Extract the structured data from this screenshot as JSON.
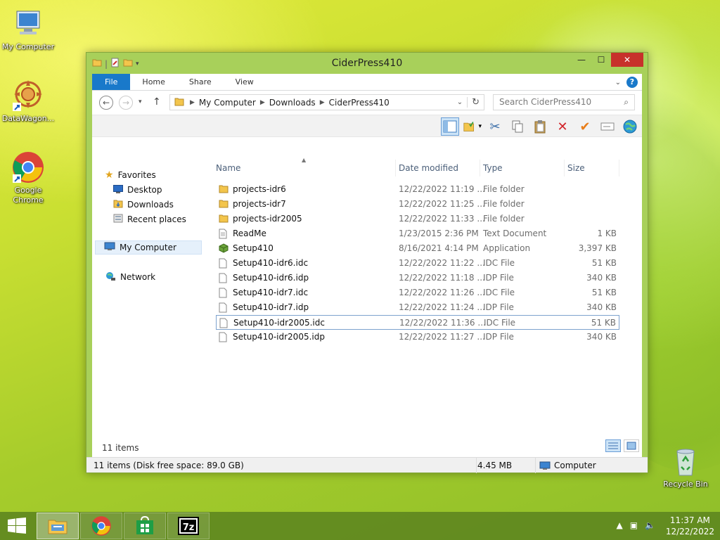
{
  "desktop": {
    "icons": [
      {
        "label": "My Computer"
      },
      {
        "label": "DataWagon..."
      },
      {
        "label": "Google Chrome"
      },
      {
        "label": "Recycle Bin"
      }
    ]
  },
  "window": {
    "title": "CiderPress410",
    "controls": {
      "minimize": "—",
      "maximize": "☐",
      "close": "✕"
    }
  },
  "ribbon": {
    "tabs": [
      "File",
      "Home",
      "Share",
      "View"
    ]
  },
  "address": {
    "crumbs": [
      "My Computer",
      "Downloads",
      "CiderPress410"
    ],
    "search_placeholder": "Search CiderPress410"
  },
  "navigation": {
    "favorites": "Favorites",
    "favorites_items": [
      "Desktop",
      "Downloads",
      "Recent places"
    ],
    "computer": "My Computer",
    "network": "Network"
  },
  "columns": {
    "name": "Name",
    "date": "Date modified",
    "type": "Type",
    "size": "Size"
  },
  "files": [
    {
      "name": "projects-idr6",
      "date": "12/22/2022 11:19 ...",
      "type": "File folder",
      "size": "",
      "icon": "folder"
    },
    {
      "name": "projects-idr7",
      "date": "12/22/2022 11:25 ...",
      "type": "File folder",
      "size": "",
      "icon": "folder"
    },
    {
      "name": "projects-idr2005",
      "date": "12/22/2022 11:33 ...",
      "type": "File folder",
      "size": "",
      "icon": "folder"
    },
    {
      "name": "ReadMe",
      "date": "1/23/2015 2:36 PM",
      "type": "Text Document",
      "size": "1 KB",
      "icon": "text"
    },
    {
      "name": "Setup410",
      "date": "8/16/2021 4:14 PM",
      "type": "Application",
      "size": "3,397 KB",
      "icon": "app"
    },
    {
      "name": "Setup410-idr6.idc",
      "date": "12/22/2022 11:22 ...",
      "type": "IDC File",
      "size": "51 KB",
      "icon": "file"
    },
    {
      "name": "Setup410-idr6.idp",
      "date": "12/22/2022 11:18 ...",
      "type": "IDP File",
      "size": "340 KB",
      "icon": "file"
    },
    {
      "name": "Setup410-idr7.idc",
      "date": "12/22/2022 11:26 ...",
      "type": "IDC File",
      "size": "51 KB",
      "icon": "file"
    },
    {
      "name": "Setup410-idr7.idp",
      "date": "12/22/2022 11:24 ...",
      "type": "IDP File",
      "size": "340 KB",
      "icon": "file"
    },
    {
      "name": "Setup410-idr2005.idc",
      "date": "12/22/2022 11:36 ...",
      "type": "IDC File",
      "size": "51 KB",
      "icon": "file"
    },
    {
      "name": "Setup410-idr2005.idp",
      "date": "12/22/2022 11:27 ...",
      "type": "IDP File",
      "size": "340 KB",
      "icon": "file"
    }
  ],
  "status": {
    "count": "11 items",
    "bar_left": "11 items (Disk free space: 89.0 GB)",
    "bar_size": "4.45 MB",
    "bar_location": "Computer"
  },
  "taskbar": {
    "time": "11:37 AM",
    "date": "12/22/2022"
  },
  "colors": {
    "accent": "#1979ca",
    "close": "#c7312b",
    "window_frame": "#a8d05a"
  }
}
